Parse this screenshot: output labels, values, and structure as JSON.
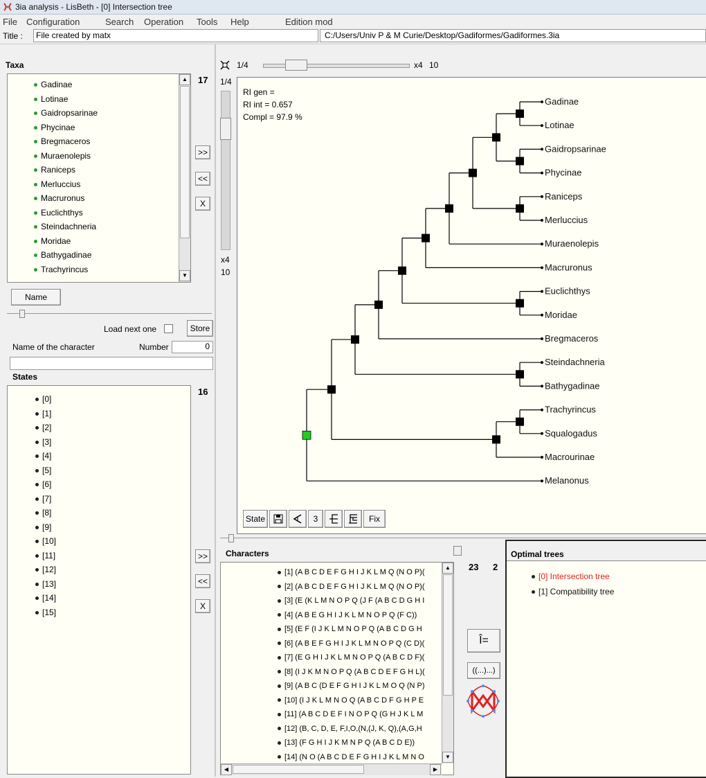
{
  "window": {
    "title": "3ia analysis - LisBeth - [0] Intersection tree"
  },
  "menu": [
    "File",
    "Configuration",
    "Search",
    "Operation",
    "Tools",
    "Help",
    "Edition mod"
  ],
  "title_row": {
    "label": "Title :",
    "value": "File created by matx",
    "path": "C:/Users/Univ P & M Curie/Desktop/Gadiformes/Gadiformes.3ia"
  },
  "taxa": {
    "header": "Taxa",
    "count": "17",
    "items": [
      "Gadinae",
      "Lotinae",
      "Gaidropsarinae",
      "Phycinae",
      "Bregmaceros",
      "Muraenolepis",
      "Raniceps",
      "Merluccius",
      "Macruronus",
      "Euclichthys",
      "Steindachneria",
      "Moridae",
      "Bathygadinae",
      "Trachyrincus"
    ],
    "btn_add": ">>",
    "btn_remove": "<<",
    "btn_clear": "X",
    "name_button": "Name"
  },
  "character_form": {
    "load_next_label": "Load next one",
    "store_button": "Store",
    "name_label": "Name of the character",
    "number_label": "Number",
    "number_value": "0",
    "name_value": ""
  },
  "states": {
    "header": "States",
    "count": "16",
    "items": [
      "[0]",
      "[1]",
      "[2]",
      "[3]",
      "[4]",
      "[5]",
      "[6]",
      "[7]",
      "[8]",
      "[9]",
      "[10]",
      "[11]",
      "[12]",
      "[13]",
      "[14]",
      "[15]"
    ],
    "btn_add": ">>",
    "btn_remove": "<<",
    "btn_clear": "X"
  },
  "tree_view": {
    "page_label": "1/4",
    "vertical_label": "1/4",
    "zoom_label": "x4",
    "zoom_value": "10",
    "v_zoom_label": "x4",
    "v_zoom_value": "10",
    "stats": {
      "ri_gen": "RI gen =",
      "ri_int": "RI int = 0.657",
      "compl": "Compl = 97.9 %"
    },
    "taxa_order": [
      "Gadinae",
      "Lotinae",
      "Gaidropsarinae",
      "Phycinae",
      "Raniceps",
      "Merluccius",
      "Muraenolepis",
      "Macruronus",
      "Euclichthys",
      "Moridae",
      "Bregmaceros",
      "Steindachneria",
      "Bathygadinae",
      "Trachyrincus",
      "Squalogadus",
      "Macrourinae",
      "Melanonus"
    ],
    "root_color": "#22cc22",
    "toolbar": {
      "state": "State",
      "number": "3",
      "fix": "Fix"
    }
  },
  "characters": {
    "header": "Characters",
    "count": "23",
    "second_count": "2",
    "items": [
      "[1] (A B C D E F G H I J K L M Q (N O P)(",
      "[2] (A B C D E F G H I J K L M Q (N O P)(",
      "[3] (E (K L M N O P Q (J F (A B C D G H I",
      "[4] (A B E G H I J K L M N O P Q (F C))",
      "[5] (E F (I J K L M N O P Q (A B C D G H",
      "[6] (A B E F G H I J K L M N O P Q (C D)(",
      "[7] (E G H I J K L M N O P Q (A B C D F)(",
      "[8] (I J K M N O P Q (A B C D E F G H L)(",
      "[9] (A B C (D E F G H I J K L M O Q (N P)",
      "[10] (I J K L M N O Q (A B C D F G H P E",
      "[11] (A B C D E F I N O P Q (G H J K L M",
      "[12] (B, C, D, E, F,I,O,(N,(J, K, Q),(A,G,H",
      "[13] (F G H I J K M N P Q (A B C D E))",
      "[14] (N O (A B C D E F G H I J K L M N O"
    ],
    "btn_add": ">>",
    "btn_remove": "<<",
    "btn_clear": "X",
    "tool_btn_1": "Î=",
    "tool_btn_2": "((...)...)"
  },
  "optimal_trees": {
    "header": "Optimal trees",
    "items": [
      {
        "label": "[0] Intersection tree",
        "color": "#dd2222"
      },
      {
        "label": "[1] Compatibility tree",
        "color": "#111111"
      }
    ]
  }
}
